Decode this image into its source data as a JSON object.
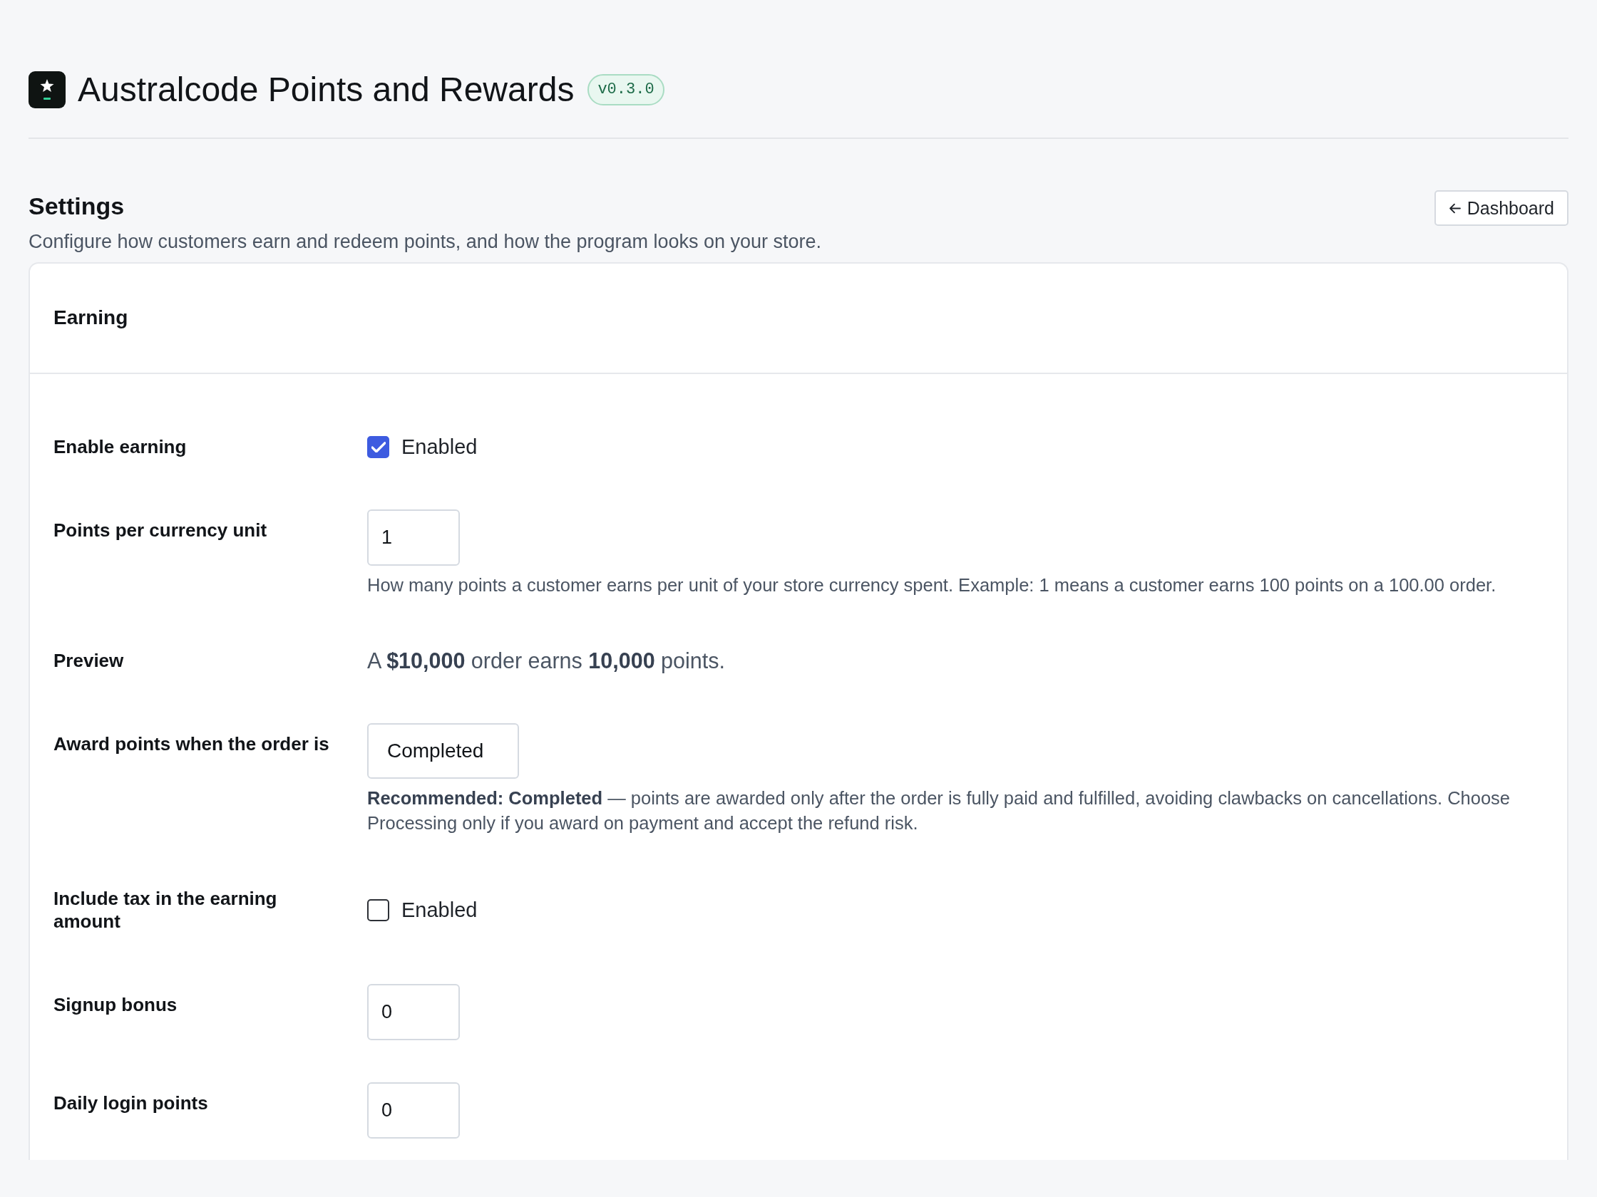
{
  "header": {
    "title": "Australcode Points and Rewards",
    "version_badge": "v0.3.0"
  },
  "page": {
    "title": "Settings",
    "subtitle": "Configure how customers earn and redeem points, and how the program looks on your store.",
    "back_button": "Dashboard"
  },
  "section": {
    "title": "Earning",
    "fields": [
      {
        "kind": "checkbox",
        "label": "Enable earning",
        "option": "Enabled",
        "checked": true
      },
      {
        "kind": "number",
        "label": "Points per currency unit",
        "value": "1",
        "help": "How many points a customer earns per unit of your store currency spent. Example: 1 means a customer earns 100 points on a 100.00 order."
      },
      {
        "kind": "text",
        "label": "Preview",
        "text": "A **$10,000** order earns **10,000** points."
      },
      {
        "kind": "select",
        "label": "Award points when the order is",
        "value": "Completed",
        "help": "**Recommended: Completed** — points are awarded only after the order is fully paid and fulfilled, avoiding clawbacks on cancellations. Choose Processing only if you award on payment and accept the refund risk."
      },
      {
        "kind": "checkbox",
        "label": "Include tax in the earning amount",
        "option": "Enabled",
        "checked": false
      },
      {
        "kind": "number",
        "label": "Signup bonus",
        "value": "0"
      },
      {
        "kind": "number",
        "label": "Daily login points",
        "value": "0"
      }
    ]
  }
}
